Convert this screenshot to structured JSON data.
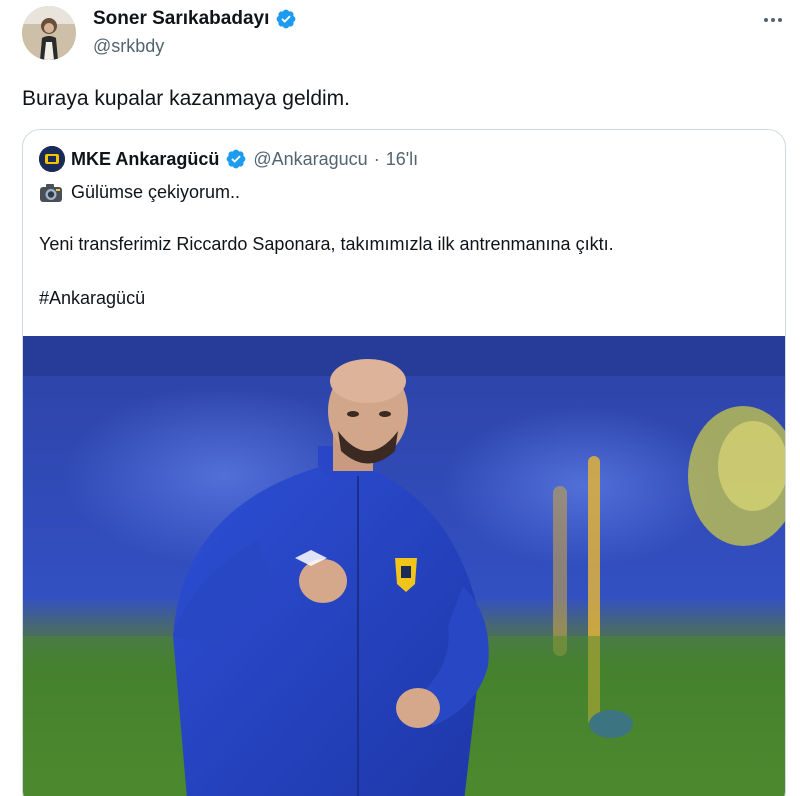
{
  "author": {
    "name": "Soner Sarıkabadayı",
    "handle": "@srkbdy"
  },
  "tweet": {
    "text": "Buraya kupalar kazanmaya geldim."
  },
  "quoted": {
    "name": "MKE Ankaragücü",
    "handle": "@Ankaragucu",
    "separator": "·",
    "time": "16'lı",
    "line1": "Gülümse çekiyorum..",
    "line2": "Yeni transferimiz Riccardo Saponara, takımımızla ilk antrenmanına çıktı.",
    "hashtag": "#Ankaragücü"
  },
  "icons": {
    "verified": "verified-badge-icon",
    "more": "more-options-icon",
    "camera": "camera-emoji-icon"
  },
  "colors": {
    "verified": "#1d9bf0",
    "text": "#0f1419",
    "secondary": "#536471",
    "border": "#cfd9de"
  }
}
